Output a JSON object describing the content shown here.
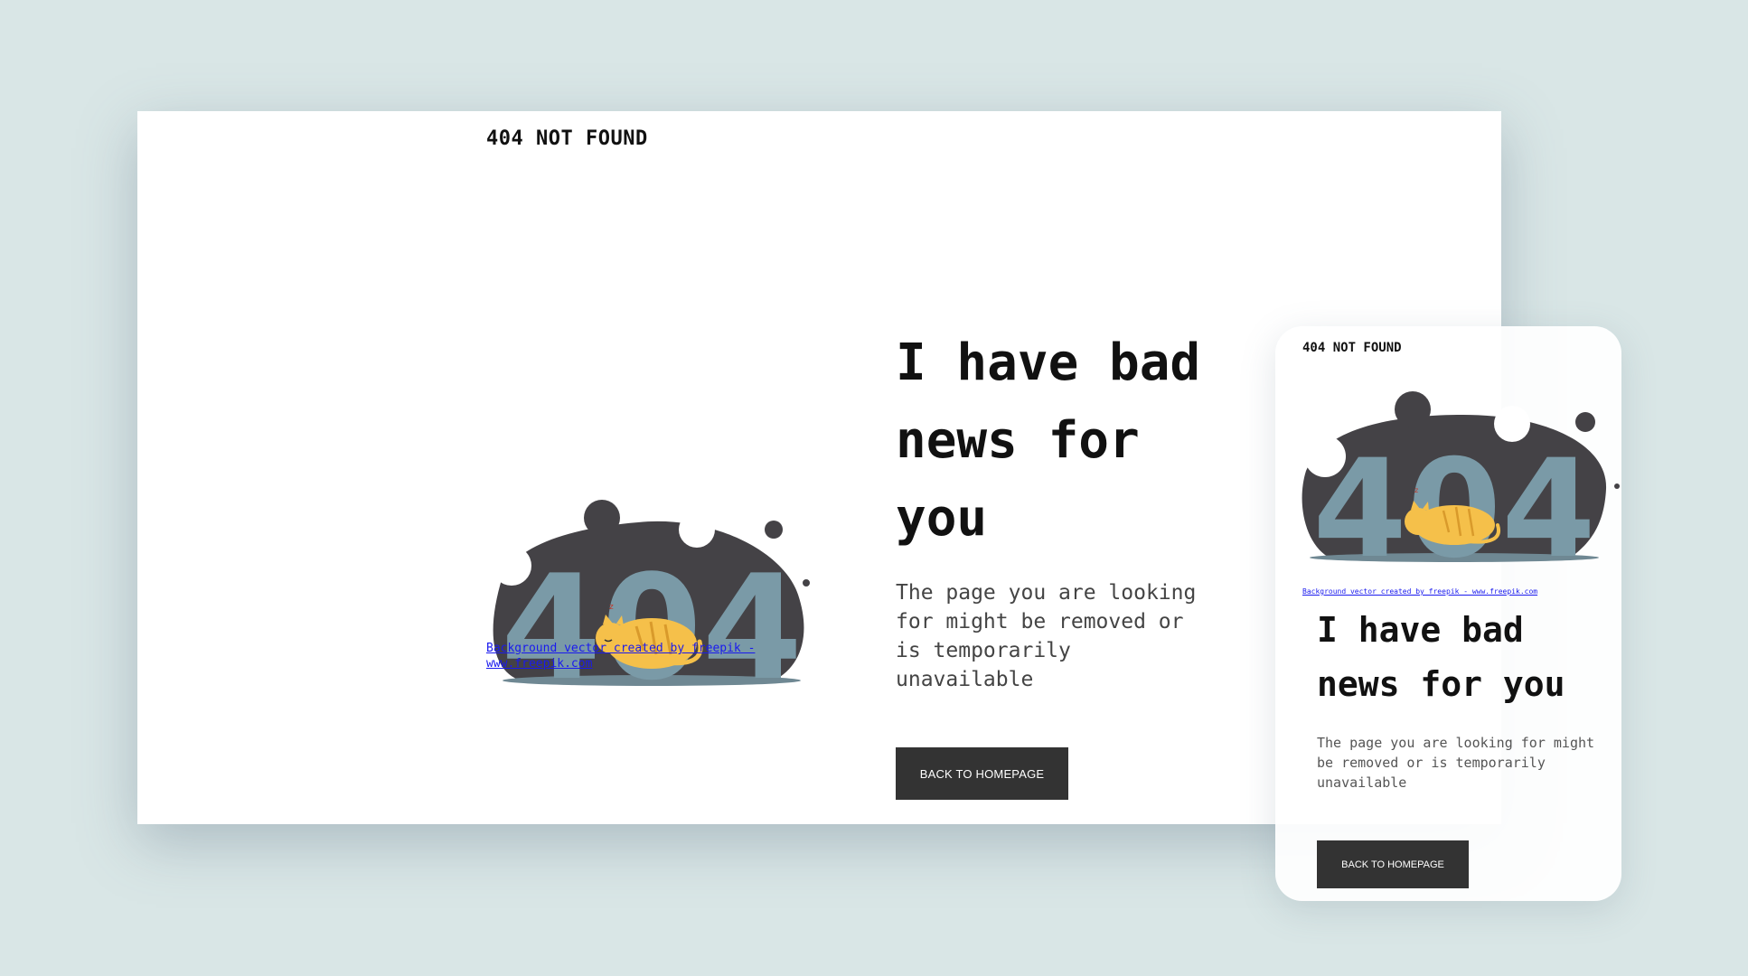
{
  "colors": {
    "background": "#d9e6e6",
    "blob": "#444246",
    "digits": "#7a9aa7",
    "cat": "#f5c04a",
    "button": "#333333"
  },
  "desktop": {
    "brand": "404 NOT FOUND",
    "illustration_digits": "404",
    "credit": "Background vector created by freepik - www.freepik.com",
    "heading": "I have bad news for you",
    "subtext": "The page you are looking for might be removed or is temporarily unavailable",
    "button_label": "BACK TO HOMEPAGE"
  },
  "mobile": {
    "brand": "404 NOT FOUND",
    "illustration_digits": "404",
    "credit": "Background vector created by freepik - www.freepik.com",
    "heading": "I have bad news for you",
    "subtext": "The page you are looking for might be removed or is temporarily unavailable",
    "button_label": "BACK TO HOMEPAGE"
  }
}
